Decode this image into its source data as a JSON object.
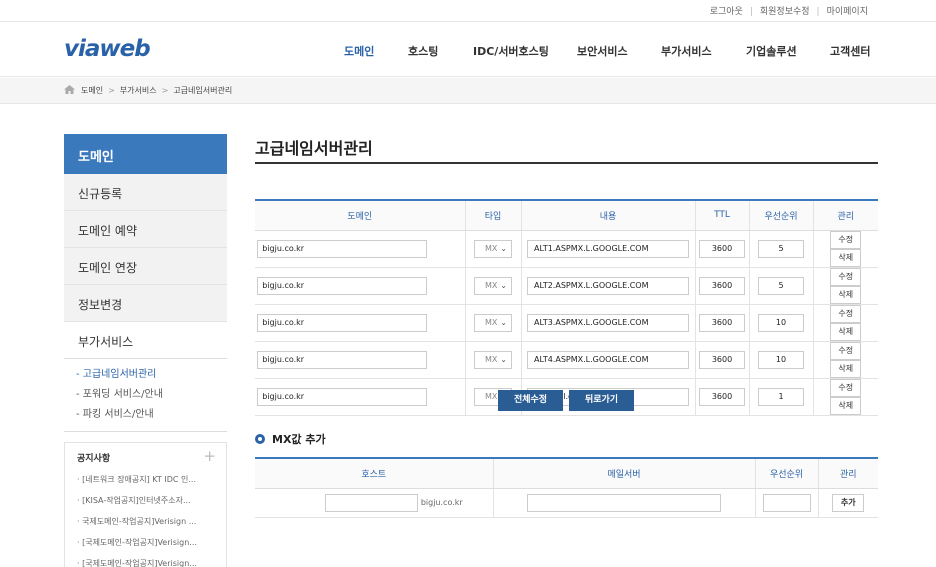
{
  "util": {
    "links": [
      "로그아웃",
      "회원정보수정",
      "마이페이지"
    ]
  },
  "header": {
    "logo": "viaweb",
    "nav": [
      "도메인",
      "호스팅",
      "IDC/서버호스팅",
      "보안서비스",
      "부가서비스",
      "기업솔루션",
      "고객센터"
    ],
    "active_nav": "도메인"
  },
  "breadcrumb": [
    "도메인",
    "부가서비스",
    "고급네임서버관리"
  ],
  "sidebar": {
    "title": "도메인",
    "items": [
      "신규등록",
      "도메인 예약",
      "도메인 연장",
      "정보변경",
      "부가서비스"
    ],
    "sub_items": [
      "- 고급네임서버관리",
      "- 포워딩 서비스/안내",
      "- 파킹 서비스/안내"
    ],
    "notice": {
      "title": "공지사항",
      "items": [
        "· [네트워크 장애공지] KT IDC 인...",
        "· [KISA-작업공지]인터넷주소자...",
        "· 국제도메인-작업공지]Verisign ...",
        "· [국제도메인-작업공지]Verisign...",
        "· [국제도메인-작업공지]Verisign..."
      ]
    }
  },
  "main": {
    "title": "고급네임서버관리",
    "table": {
      "headers": [
        "도메인",
        "타입",
        "내용",
        "TTL",
        "우선순위",
        "관리"
      ],
      "rows": [
        {
          "domain": "bigju.co.kr",
          "type": "MX",
          "content": "ALT1.ASPMX.L.GOOGLE.COM",
          "ttl": "3600",
          "priority": "5"
        },
        {
          "domain": "bigju.co.kr",
          "type": "MX",
          "content": "ALT2.ASPMX.L.GOOGLE.COM",
          "ttl": "3600",
          "priority": "5"
        },
        {
          "domain": "bigju.co.kr",
          "type": "MX",
          "content": "ALT3.ASPMX.L.GOOGLE.COM",
          "ttl": "3600",
          "priority": "10"
        },
        {
          "domain": "bigju.co.kr",
          "type": "MX",
          "content": "ALT4.ASPMX.L.GOOGLE.COM",
          "ttl": "3600",
          "priority": "10"
        },
        {
          "domain": "bigju.co.kr",
          "type": "MX",
          "content": "aspmx.l.google.com.",
          "ttl": "3600",
          "priority": "1"
        }
      ],
      "edit_label": "수정",
      "delete_label": "삭제"
    },
    "buttons": {
      "save_all": "전체수정",
      "back": "뒤로가기"
    },
    "mx_add": {
      "title": "MX값 추가",
      "headers": [
        "호스트",
        "메일서버",
        "우선순위",
        "관리"
      ],
      "domain_suffix": "bigju.co.kr",
      "add_label": "추가"
    }
  },
  "colors": {
    "accent": "#3b79bd",
    "button": "#2a5d94"
  }
}
